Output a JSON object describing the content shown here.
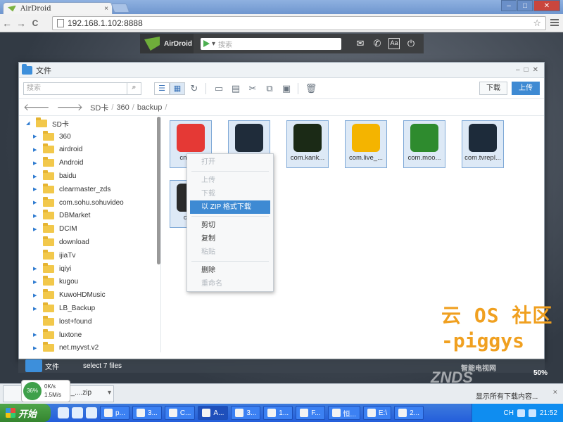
{
  "browser": {
    "tab_title": "AirDroid",
    "tab_close": "×",
    "url": "192.168.1.102:8888",
    "back_icon": "←",
    "forward_icon": "→",
    "reload_icon": "C",
    "star_icon": "☆",
    "min": "–",
    "max": "□",
    "close": "✕"
  },
  "airdroid": {
    "logo_text": "AirDroid",
    "search_placeholder": "搜索",
    "dropdown": "▾",
    "icons": [
      "✉",
      "✆",
      "Aa",
      "⏻"
    ]
  },
  "file_window": {
    "title": "文件",
    "win_buttons": [
      "–",
      "□",
      "✕"
    ],
    "search_placeholder": "搜索",
    "search_icon": "⌕",
    "view_list": "☰",
    "view_grid": "▦",
    "tool_icons": [
      "↻",
      "▭",
      "▤",
      "✂",
      "⧉",
      "▣",
      "🗑"
    ],
    "download_label": "下载",
    "upload_label": "上传",
    "breadcrumb": [
      "SD卡",
      "360",
      "backup"
    ],
    "breadcrumb_sep": "/",
    "tree_root": "SD卡",
    "tree": [
      {
        "name": "360",
        "expand": true
      },
      {
        "name": "airdroid",
        "expand": true
      },
      {
        "name": "Android",
        "expand": true
      },
      {
        "name": "baidu",
        "expand": true
      },
      {
        "name": "clearmaster_zds",
        "expand": true
      },
      {
        "name": "com.sohu.sohuvideo",
        "expand": true
      },
      {
        "name": "DBMarket",
        "expand": true
      },
      {
        "name": "DCIM",
        "expand": true
      },
      {
        "name": "download",
        "expand": false
      },
      {
        "name": "ijiaTv",
        "expand": false
      },
      {
        "name": "iqiyi",
        "expand": true
      },
      {
        "name": "kugou",
        "expand": true
      },
      {
        "name": "KuwoHDMusic",
        "expand": true
      },
      {
        "name": "LB_Backup",
        "expand": true
      },
      {
        "name": "lost+found",
        "expand": false
      },
      {
        "name": "luxtone",
        "expand": true
      },
      {
        "name": "net.myvst.v2",
        "expand": true
      }
    ],
    "files": [
      {
        "name": "cn.en...",
        "color": "#e53935"
      },
      {
        "name": "",
        "color": "#1f2c3a"
      },
      {
        "name": "com.kank...",
        "color": "#1b2a16"
      },
      {
        "name": "com.live_...",
        "color": "#f4b400"
      },
      {
        "name": "com.moo...",
        "color": "#2e8b2e"
      },
      {
        "name": "com.tvrepl...",
        "color": "#1d2b3a"
      },
      {
        "name": "com.",
        "color": "#2a2a2a"
      }
    ],
    "status_label": "文件",
    "status_count": "select 7 files"
  },
  "context_menu": {
    "items": [
      {
        "label": "打开",
        "enabled": false
      },
      {
        "divider": true
      },
      {
        "label": "上传",
        "enabled": false
      },
      {
        "label": "下载",
        "enabled": false
      },
      {
        "label": "以 ZIP 格式下载",
        "enabled": true,
        "highlight": true
      },
      {
        "divider": true
      },
      {
        "label": "剪切",
        "enabled": true
      },
      {
        "label": "复制",
        "enabled": true
      },
      {
        "label": "粘贴",
        "enabled": false
      },
      {
        "divider": true
      },
      {
        "label": "删除",
        "enabled": true
      },
      {
        "label": "重命名",
        "enabled": false
      }
    ]
  },
  "download_bar": {
    "file_name": "d_....zip",
    "progress_percent": "36%",
    "upload_speed": "0K/s",
    "download_speed": "1.5M/s",
    "status_text": "显示所有下载内容...",
    "close": "×"
  },
  "watermark": {
    "line1": "云 OS 社区",
    "line2": "-piggys",
    "brand": "ZNDS",
    "brand_sub": "智能电视网",
    "zoom": "50%"
  },
  "taskbar": {
    "start_label": "开始",
    "items": [
      "p...",
      "3...",
      "C...",
      "A...",
      "3...",
      "1...",
      "F...",
      "恒...",
      "E:\\",
      "2..."
    ],
    "lang": "CH",
    "clock": "21:52"
  }
}
